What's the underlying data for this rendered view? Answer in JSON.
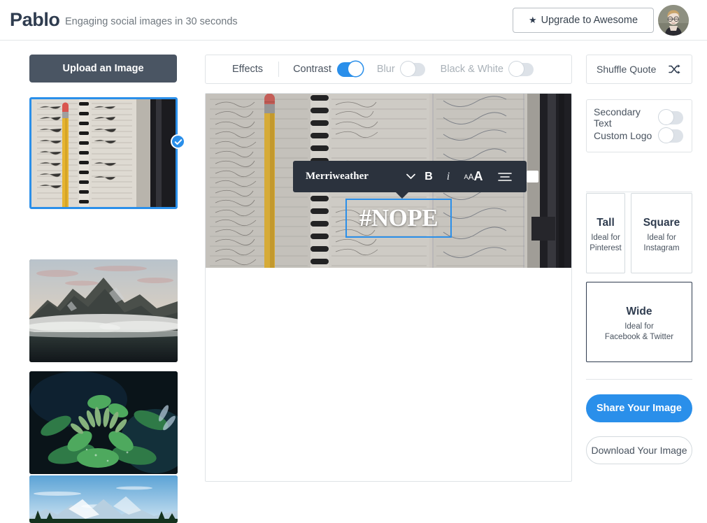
{
  "header": {
    "brand": "Pablo",
    "tagline": "Engaging social images in 30 seconds",
    "upgrade_label": "Upgrade to Awesome",
    "upgrade_star": "★",
    "avatar_icon": "user-avatar-photo"
  },
  "left": {
    "upload_label": "Upload an Image",
    "thumbnails": [
      {
        "alt": "spiral notebook planner with pencil",
        "selected": true
      },
      {
        "alt": "misty mountain lake at dusk",
        "selected": false
      },
      {
        "alt": "green plant buds with dew",
        "selected": false
      },
      {
        "alt": "snowy mountain under blue sky",
        "selected": false
      }
    ],
    "check_icon": "checkmark-icon"
  },
  "effects": {
    "label": "Effects",
    "items": [
      {
        "label": "Contrast",
        "state": "on"
      },
      {
        "label": "Blur",
        "state": "off"
      },
      {
        "label": "Black & White",
        "state": "off"
      }
    ]
  },
  "canvas": {
    "image_alt": "spiral notebook planner with handwriting and yellow pencil",
    "text": "#NOPE",
    "toolbar": {
      "font_name": "Merriweather",
      "chevron_icon": "chevron-down-icon",
      "bold_label": "B",
      "italic_label": "i",
      "size_small": "A",
      "size_medium": "A",
      "size_large": "A",
      "align_icon": "text-align-icon",
      "color_swatch": "#ffffff"
    }
  },
  "right": {
    "shuffle_label": "Shuffle Quote",
    "shuffle_icon": "shuffle-icon",
    "options": [
      {
        "label": "Secondary Text",
        "state": "off"
      },
      {
        "label": "Custom Logo",
        "state": "off"
      }
    ],
    "sizes": [
      {
        "name": "Tall",
        "desc": "Ideal for\nPinterest",
        "selected": false
      },
      {
        "name": "Square",
        "desc": "Ideal for\nInstagram",
        "selected": false
      },
      {
        "name": "Wide",
        "desc": "Ideal for\nFacebook & Twitter",
        "selected": true
      }
    ],
    "share_label": "Share Your Image",
    "download_label": "Download Your Image"
  },
  "colors": {
    "accent_blue": "#2a8fea",
    "dark_slate": "#2b323d",
    "upload_slate": "#4a5563",
    "text_dark": "#2f3c4f",
    "text_muted": "#70787f",
    "toggle_off": "#dde2e8"
  }
}
